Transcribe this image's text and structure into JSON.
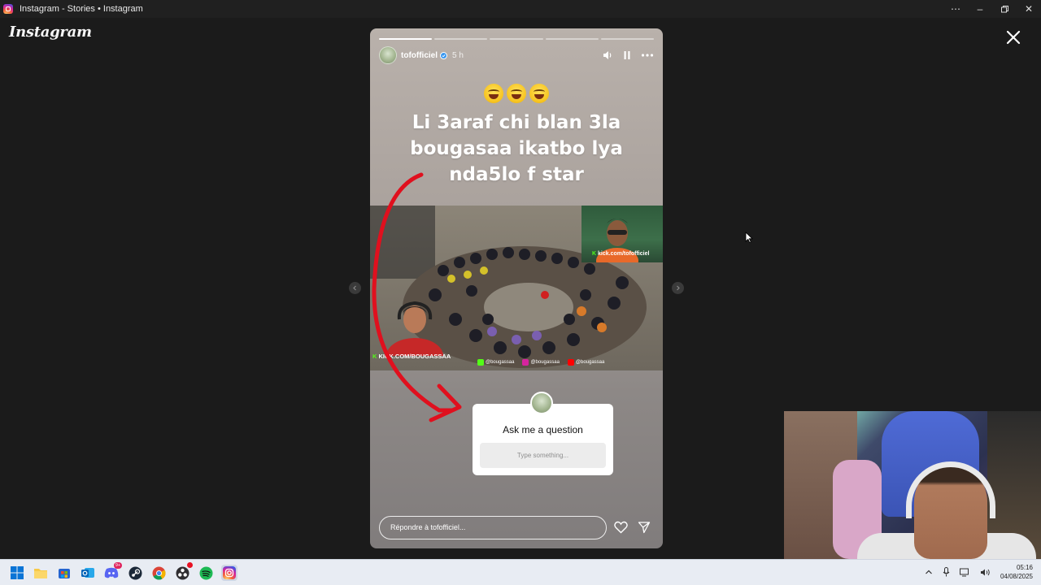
{
  "window": {
    "title": "Instagram - Stories • Instagram",
    "controls": [
      "more",
      "minimize",
      "restore",
      "close"
    ]
  },
  "brand": {
    "logo_text": "Instagram"
  },
  "story": {
    "username": "tofofficiel",
    "time_ago": "5 h",
    "progress_segments": 5,
    "progress_complete": 1,
    "caption_lines": [
      "Li 3araf chi blan 3la",
      "bougasaa ikatbo lya",
      "nda5lo f star"
    ],
    "clip": {
      "kick_overlay": "kick.com/tofofficiel",
      "bottom_tag": "KICK.COM/BOUGASSAA",
      "socials": [
        "@bougassaa",
        "@bougassaa",
        "@bougassaa"
      ]
    },
    "question_sticker": {
      "title": "Ask me a question",
      "placeholder": "Type something..."
    },
    "reply_placeholder": "Répondre à tofofficiel..."
  },
  "taskbar": {
    "time": "05:16",
    "date": "04/08/2025",
    "discord_badge": "9+"
  },
  "colors": {
    "kick_green": "#53fc18",
    "arrow_red": "#e0101e",
    "instagram_gradient_start": "#fdd66b",
    "instagram_gradient_end": "#285AEB"
  }
}
